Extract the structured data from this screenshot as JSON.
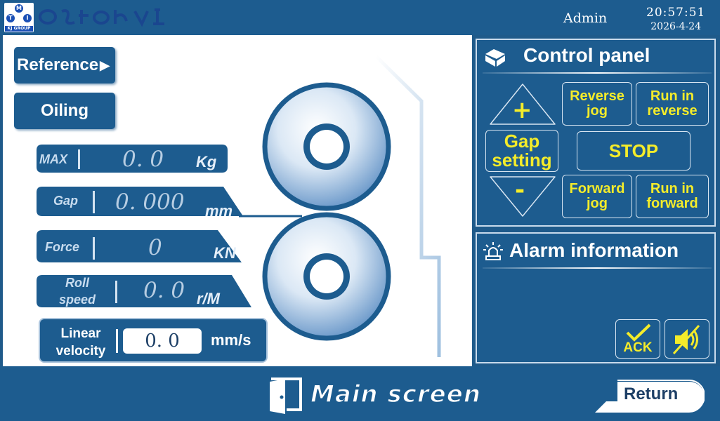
{
  "header": {
    "logo_letters": [
      "M",
      "T",
      "I"
    ],
    "logo_group": "KJ GROUP",
    "user": "Admin",
    "time": "20:57:51",
    "date": "2026-4-24"
  },
  "side_buttons": {
    "reference_label": "Reference",
    "oiling_label": "Oiling"
  },
  "fields": {
    "max": {
      "label": "MAX",
      "value": "0. 0",
      "unit": "Kg"
    },
    "gap": {
      "label": "Gap",
      "value": "0. 000",
      "unit": "mm"
    },
    "force": {
      "label": "Force",
      "value": "0",
      "unit": "KN"
    },
    "roll_speed": {
      "label_line1": "Roll",
      "label_line2": "speed",
      "value": "0. 0",
      "unit": "r/M"
    },
    "linear_velocity": {
      "label_line1": "Linear",
      "label_line2": "velocity",
      "value": "0. 0",
      "unit": "mm/s"
    }
  },
  "control_panel": {
    "title": "Control panel",
    "plus": "+",
    "minus": "-",
    "gap_setting_line1": "Gap",
    "gap_setting_line2": "setting",
    "reverse_jog_line1": "Reverse",
    "reverse_jog_line2": "jog",
    "run_reverse_line1": "Run in",
    "run_reverse_line2": "reverse",
    "stop": "STOP",
    "forward_jog_line1": "Forward",
    "forward_jog_line2": "jog",
    "run_forward_line1": "Run in",
    "run_forward_line2": "forward"
  },
  "alarm": {
    "title": "Alarm information",
    "ack_label": "ACK"
  },
  "footer": {
    "main_screen": "Main screen",
    "return_label": "Return"
  },
  "colors": {
    "panel": "#1d5c8f",
    "button_text": "#f4ec2a",
    "roller_light": "#ffffff",
    "roller_dark": "#4f86bf"
  }
}
